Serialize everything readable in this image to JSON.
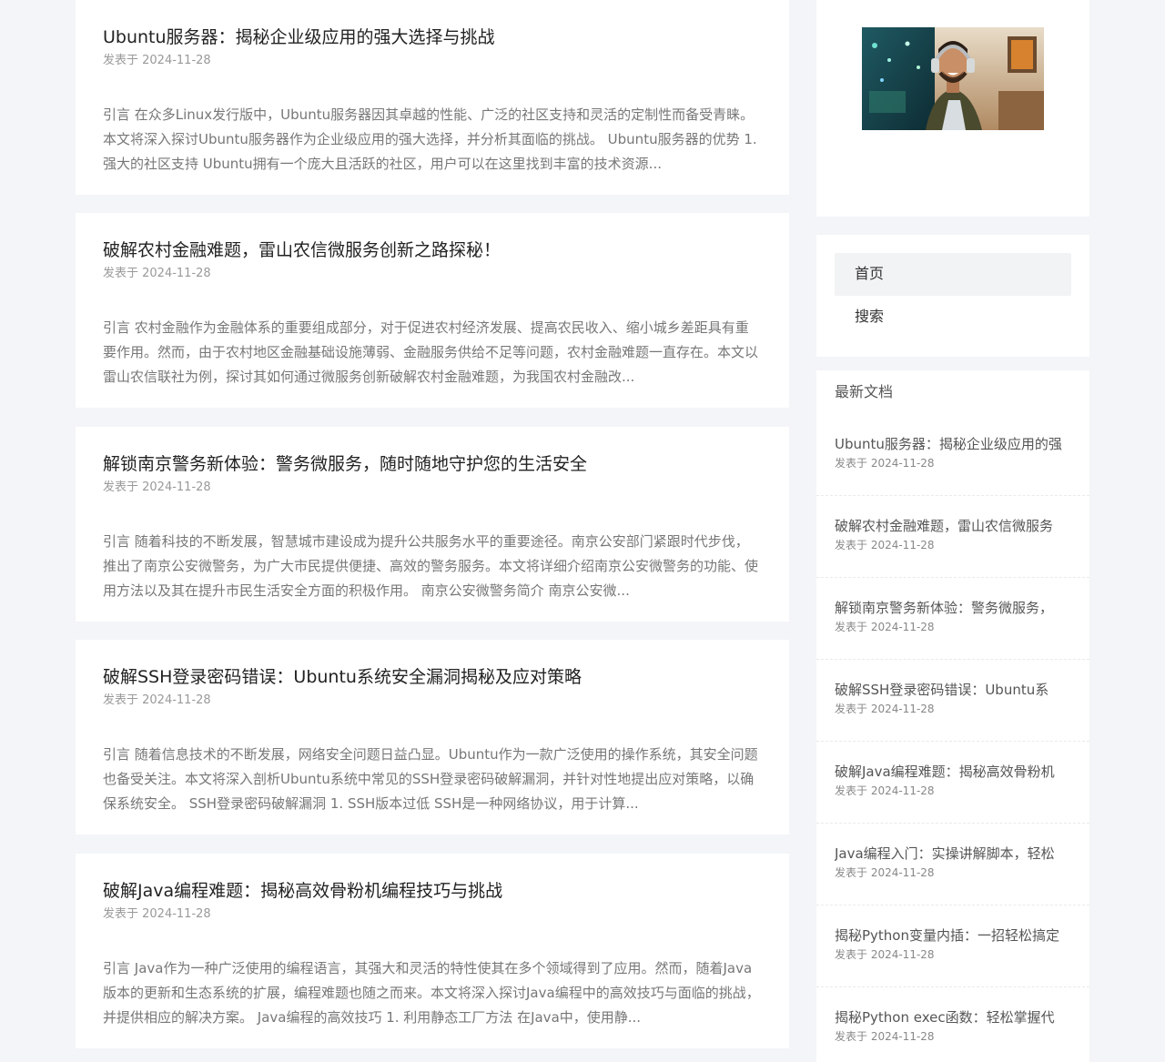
{
  "posts": [
    {
      "title": "Ubuntu服务器：揭秘企业级应用的强大选择与挑战",
      "date": "发表于 2024-11-28",
      "excerpt": "引言 在众多Linux发行版中，Ubuntu服务器因其卓越的性能、广泛的社区支持和灵活的定制性而备受青睐。本文将深入探讨Ubuntu服务器作为企业级应用的强大选择，并分析其面临的挑战。 Ubuntu服务器的优势 1. 强大的社区支持 Ubuntu拥有一个庞大且活跃的社区，用户可以在这里找到丰富的技术资源..."
    },
    {
      "title": "破解农村金融难题，雷山农信微服务创新之路探秘！",
      "date": "发表于 2024-11-28",
      "excerpt": "引言 农村金融作为金融体系的重要组成部分，对于促进农村经济发展、提高农民收入、缩小城乡差距具有重要作用。然而，由于农村地区金融基础设施薄弱、金融服务供给不足等问题，农村金融难题一直存在。本文以雷山农信联社为例，探讨其如何通过微服务创新破解农村金融难题，为我国农村金融改..."
    },
    {
      "title": "解锁南京警务新体验：警务微服务，随时随地守护您的生活安全",
      "date": "发表于 2024-11-28",
      "excerpt": "引言 随着科技的不断发展，智慧城市建设成为提升公共服务水平的重要途径。南京公安部门紧跟时代步伐，推出了南京公安微警务，为广大市民提供便捷、高效的警务服务。本文将详细介绍南京公安微警务的功能、使用方法以及其在提升市民生活安全方面的积极作用。 南京公安微警务简介 南京公安微..."
    },
    {
      "title": "破解SSH登录密码错误：Ubuntu系统安全漏洞揭秘及应对策略",
      "date": "发表于 2024-11-28",
      "excerpt": "引言 随着信息技术的不断发展，网络安全问题日益凸显。Ubuntu作为一款广泛使用的操作系统，其安全问题也备受关注。本文将深入剖析Ubuntu系统中常见的SSH登录密码破解漏洞，并针对性地提出应对策略，以确保系统安全。 SSH登录密码破解漏洞 1. SSH版本过低 SSH是一种网络协议，用于计算..."
    },
    {
      "title": "破解Java编程难题：揭秘高效骨粉机编程技巧与挑战",
      "date": "发表于 2024-11-28",
      "excerpt": "引言 Java作为一种广泛使用的编程语言，其强大和灵活的特性使其在多个领域得到了应用。然而，随着Java版本的更新和生态系统的扩展，编程难题也随之而来。本文将深入探讨Java编程中的高效技巧与面临的挑战，并提供相应的解决方案。 Java编程的高效技巧 1. 利用静态工厂方法 在Java中，使用静..."
    }
  ],
  "sidebar": {
    "nav": [
      {
        "label": "首页"
      },
      {
        "label": "搜索"
      }
    ],
    "latest_heading": "最新文档",
    "latest": [
      {
        "title": "Ubuntu服务器：揭秘企业级应用的强",
        "date": "发表于 2024-11-28"
      },
      {
        "title": "破解农村金融难题，雷山农信微服务",
        "date": "发表于 2024-11-28"
      },
      {
        "title": "解锁南京警务新体验：警务微服务，",
        "date": "发表于 2024-11-28"
      },
      {
        "title": "破解SSH登录密码错误：Ubuntu系",
        "date": "发表于 2024-11-28"
      },
      {
        "title": "破解Java编程难题：揭秘高效骨粉机",
        "date": "发表于 2024-11-28"
      },
      {
        "title": "Java编程入门：实操讲解脚本，轻松",
        "date": "发表于 2024-11-28"
      },
      {
        "title": "揭秘Python变量内插：一招轻松搞定",
        "date": "发表于 2024-11-28"
      },
      {
        "title": "揭秘Python exec函数：轻松掌握代",
        "date": "发表于 2024-11-28"
      }
    ]
  }
}
